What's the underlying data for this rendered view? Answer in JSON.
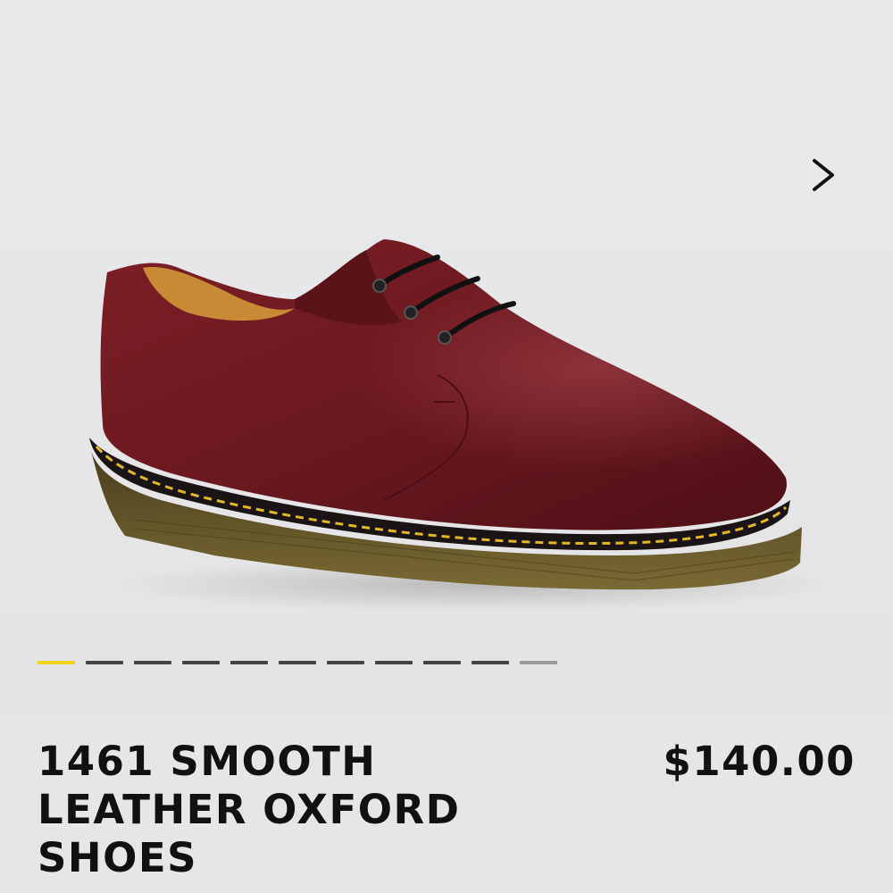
{
  "product": {
    "title": "1461 SMOOTH LEATHER OXFORD SHOES",
    "price": "$140.00"
  },
  "gallery": {
    "next_icon": "chevron-right-icon",
    "image_count": 11,
    "active_index": 0,
    "colors": {
      "active_dot": "#f2d21b",
      "inactive_dot": "#444444",
      "faded_dot": "#9a9a9a",
      "background": "#e6e6e8",
      "leather": "#6e1a1f",
      "stitch": "#e2b824",
      "sole": "#5a4a22"
    }
  }
}
